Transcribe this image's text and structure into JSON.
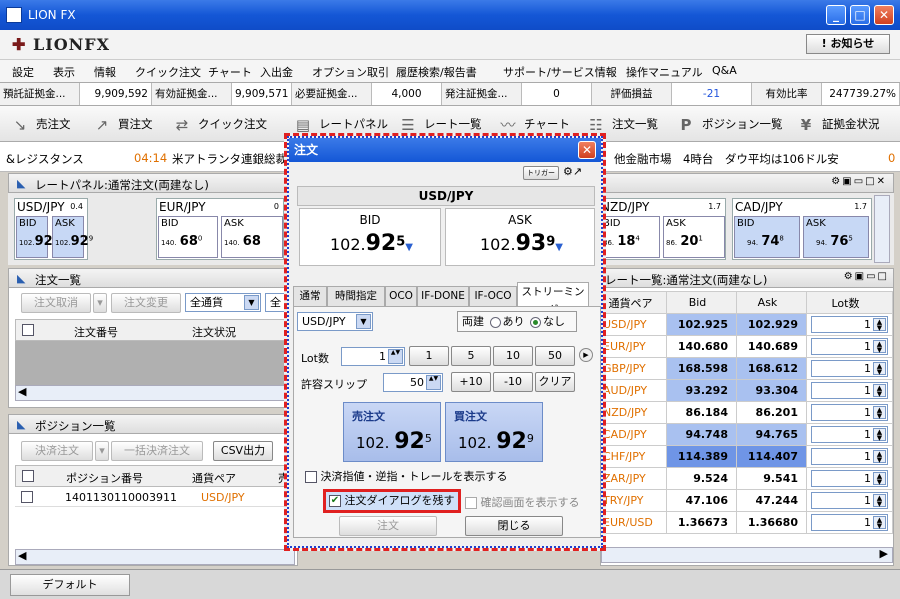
{
  "window": {
    "title": "LION FX",
    "min": "_",
    "max": "□",
    "close": "✕"
  },
  "brand": {
    "logo": "LIONFX",
    "notice_button": "! お知らせ"
  },
  "menu": [
    "設定",
    "表示",
    "情報",
    "クイック注文",
    "チャート",
    "入出金",
    "オプション取引",
    "履歴検索/報告書",
    "サポート/サービス情報",
    "操作マニュアル",
    "Q&A"
  ],
  "account": [
    {
      "label": "預託証拠金...",
      "value": "9,909,592"
    },
    {
      "label": "有効証拠金...",
      "value": "9,909,571"
    },
    {
      "label": "必要証拠金...",
      "value": "4,000"
    },
    {
      "label": "発注証拠金...",
      "value": "0"
    },
    {
      "label": "評価損益",
      "value": "-21"
    },
    {
      "label": "有効比率",
      "value": "247739.27%"
    }
  ],
  "toolbar": [
    "売注文",
    "買注文",
    "クイック注文",
    "レートパネル",
    "レート一覧",
    "チャート",
    "注文一覧",
    "ポジション一覧",
    "証拠金状況"
  ],
  "ticker": {
    "left": "&レジスタンス",
    "time": "04:14",
    "headline": "米アトランタ連銀総裁",
    "right": "他金融市場　4時台　ダウ平均は106ドル安",
    "right_time": "0"
  },
  "rate_panel": {
    "title": "レートパネル:通常注文(両建なし)",
    "cards": [
      {
        "pair": "USD/JPY",
        "spread": "0.4",
        "bid_lbl": "BID",
        "ask_lbl": "ASK",
        "bid_small": "102.",
        "bid_big": "92",
        "bid_pip": "5",
        "ask_small": "102.",
        "ask_big": "92",
        "ask_pip": "9"
      },
      {
        "pair": "EUR/JPY",
        "spread": "0",
        "bid_lbl": "BID",
        "ask_lbl": "ASK",
        "bid_small": "140.",
        "bid_big": "68",
        "bid_pip": "0",
        "ask_small": "140.",
        "ask_big": "68",
        "ask_pip": ""
      },
      {
        "pair": "NZD/JPY",
        "spread": "1.7",
        "bid_lbl": "BID",
        "ask_lbl": "ASK",
        "bid_small": "86.",
        "bid_big": "18",
        "bid_pip": "4",
        "ask_small": "86.",
        "ask_big": "20",
        "ask_pip": "1"
      },
      {
        "pair": "CAD/JPY",
        "spread": "1.7",
        "bid_lbl": "BID",
        "ask_lbl": "ASK",
        "bid_small": "94.",
        "bid_big": "74",
        "bid_pip": "8",
        "ask_small": "94.",
        "ask_big": "76",
        "ask_pip": "5"
      }
    ]
  },
  "order_list": {
    "title": "注文一覧",
    "cancel": "注文取消",
    "change": "注文変更",
    "filter": "全通貨",
    "filter2": "全",
    "col_no": "注文番号",
    "col_status": "注文状況"
  },
  "position_list": {
    "title": "ポジション一覧",
    "settle": "決済注文",
    "bulk": "一括決済注文",
    "csv": "CSV出力",
    "col_no": "ポジション番号",
    "col_pair": "通貨ペア",
    "col_side": "売",
    "rows": [
      {
        "no": "1401130110003911",
        "pair": "USD/JPY"
      }
    ]
  },
  "rate_list": {
    "title": "レート一覧:通常注文(両建なし)",
    "col_pair": "通貨ペア",
    "col_bid": "Bid",
    "col_ask": "Ask",
    "col_lot": "Lot数",
    "rows": [
      {
        "pair": "USD/JPY",
        "bid": "102.925",
        "ask": "102.929",
        "lot": "1",
        "hl": true
      },
      {
        "pair": "EUR/JPY",
        "bid": "140.680",
        "ask": "140.689",
        "lot": "1",
        "hl": false
      },
      {
        "pair": "GBP/JPY",
        "bid": "168.598",
        "ask": "168.612",
        "lot": "1",
        "hl": true
      },
      {
        "pair": "AUD/JPY",
        "bid": "93.292",
        "ask": "93.304",
        "lot": "1",
        "hl": true
      },
      {
        "pair": "NZD/JPY",
        "bid": "86.184",
        "ask": "86.201",
        "lot": "1",
        "hl": false
      },
      {
        "pair": "CAD/JPY",
        "bid": "94.748",
        "ask": "94.765",
        "lot": "1",
        "hl": true
      },
      {
        "pair": "CHF/JPY",
        "bid": "114.389",
        "ask": "114.407",
        "lot": "1",
        "hl": "dark"
      },
      {
        "pair": "ZAR/JPY",
        "bid": "9.524",
        "ask": "9.541",
        "lot": "1",
        "hl": false
      },
      {
        "pair": "TRY/JPY",
        "bid": "47.106",
        "ask": "47.244",
        "lot": "1",
        "hl": false
      },
      {
        "pair": "EUR/USD",
        "bid": "1.36673",
        "ask": "1.36680",
        "lot": "1",
        "hl": false
      }
    ]
  },
  "dialog": {
    "title": "注文",
    "close": "✕",
    "trigger": "トリガー",
    "pair": "USD/JPY",
    "bid_lbl": "BID",
    "bid_small": "102.",
    "bid_big": "92",
    "bid_pip": "5",
    "ask_lbl": "ASK",
    "ask_small": "102.",
    "ask_big": "93",
    "ask_pip": "9",
    "tabs": [
      "通常",
      "時間指定",
      "OCO",
      "IF-DONE",
      "IF-OCO",
      "ストリーミング"
    ],
    "pair_select": "USD/JPY",
    "hedge_label": "両建",
    "hedge_yes": "あり",
    "hedge_no": "なし",
    "lot_label": "Lot数",
    "lot_value": "1",
    "lot_presets": [
      "1",
      "5",
      "10",
      "50"
    ],
    "slip_label": "許容スリップ",
    "slip_value": "50",
    "slip_plus": "+10",
    "slip_minus": "-10",
    "clear": "クリア",
    "sell_lbl": "売注文",
    "sell_small": "102.",
    "sell_big": "92",
    "sell_pip": "5",
    "buy_lbl": "買注文",
    "buy_small": "102.",
    "buy_big": "92",
    "buy_pip": "9",
    "show_settle": "決済指値・逆指・トレールを表示する",
    "keep_dialog": "注文ダイアログを残す",
    "confirm": "確認画面を表示する",
    "order_btn": "注文",
    "close_btn": "閉じる"
  },
  "statusbar": {
    "tab": "デフォルト"
  },
  "colors": {
    "accent": "#1457d6",
    "highlight": "#e02020",
    "rate_blue": "#a9c1f0",
    "pair_orange": "#e07000"
  }
}
